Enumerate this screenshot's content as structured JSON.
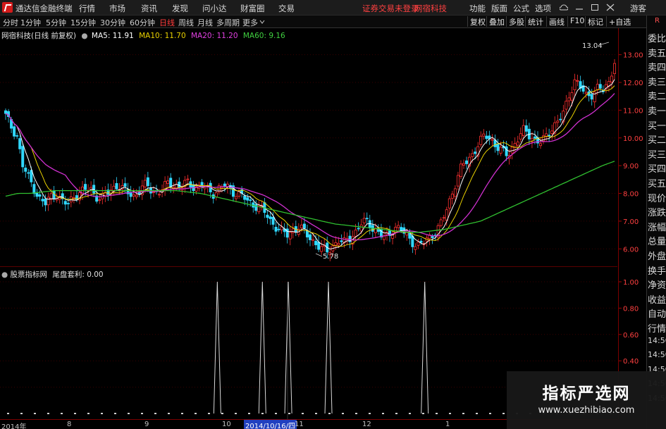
{
  "app": {
    "title": "通达信金融终端",
    "menu": [
      "行情",
      "市场",
      "资讯",
      "发现",
      "问小达",
      "财富圈",
      "交易"
    ],
    "notice_warn": "证券交易未登录",
    "notice_stock": "网宿科技",
    "right_menu": [
      "功能",
      "版面",
      "公式",
      "选项"
    ],
    "guest": "游客"
  },
  "toolbar": {
    "periods": [
      "分时",
      "1分钟",
      "5分钟",
      "15分钟",
      "30分钟",
      "60分钟",
      "日线",
      "周线",
      "月线",
      "多周期",
      "更多"
    ],
    "active_period": "日线",
    "right_buttons": [
      "复权",
      "叠加",
      "多股",
      "统计",
      "画线",
      "F10",
      "标记",
      "+自选"
    ]
  },
  "main_chart": {
    "header": "网宿科技(日线 前复权)",
    "ma": [
      {
        "label": "MA5: 11.91",
        "color": "#ffffff"
      },
      {
        "label": "MA10: 11.70",
        "color": "#e8d000"
      },
      {
        "label": "MA20: 11.20",
        "color": "#e040e0"
      },
      {
        "label": "MA60: 9.16",
        "color": "#40d040"
      }
    ],
    "high_label": "13.04",
    "low_label": "5.78"
  },
  "sub_chart": {
    "header": "股票指标网",
    "indicator": "尾盘套利: 0.00"
  },
  "axis": {
    "price_ticks": [
      "13.00",
      "12.00",
      "11.00",
      "10.00",
      "9.00",
      "8.00",
      "7.00",
      "6.00"
    ],
    "sub_ticks": [
      "1.00",
      "0.80",
      "0.60",
      "0.40"
    ],
    "date_labels": [
      "2014年",
      "8",
      "9",
      "10",
      "11",
      "12",
      "1"
    ],
    "highlight_date": "2014/10/16/四"
  },
  "sidebar": {
    "top_label": "R",
    "items": [
      "委比",
      "卖五",
      "卖四",
      "卖三",
      "卖二",
      "卖一",
      "买一",
      "买二",
      "买三",
      "买四",
      "买五",
      "现价",
      "涨跌",
      "涨幅",
      "总量",
      "外盘",
      "换手",
      "净资",
      "收益",
      "自动",
      "行情",
      "14:50",
      "14:50",
      "14:50",
      "14:50",
      "14:50"
    ]
  },
  "watermark": {
    "title": "指标严选网",
    "url": "www.xuezhibiao.com"
  },
  "chart_data": {
    "type": "candlestick",
    "price_range": [
      5.5,
      13.6
    ],
    "close_series_approx": [
      10.8,
      10.4,
      10.1,
      9.0,
      8.6,
      8.2,
      7.8,
      7.6,
      7.9,
      8.0,
      7.7,
      7.6,
      7.9,
      8.0,
      8.1,
      8.2,
      7.9,
      7.8,
      8.0,
      8.2,
      8.3,
      8.1,
      8.0,
      7.9,
      8.2,
      8.3,
      8.1,
      8.0,
      8.2,
      8.4,
      8.3,
      8.2,
      8.4,
      8.3,
      8.2,
      8.3,
      8.1,
      8.0,
      8.2,
      8.3,
      8.1,
      8.0,
      7.9,
      7.7,
      7.6,
      7.5,
      7.3,
      7.0,
      6.8,
      6.6,
      6.5,
      6.7,
      6.8,
      6.6,
      6.4,
      6.2,
      6.0,
      5.9,
      6.1,
      6.3,
      6.2,
      6.4,
      6.6,
      6.9,
      7.0,
      6.8,
      6.6,
      6.4,
      6.5,
      6.8,
      6.7,
      6.5,
      6.3,
      6.1,
      6.2,
      6.4,
      6.6,
      6.8,
      7.3,
      7.9,
      8.5,
      9.0,
      9.2,
      9.5,
      9.8,
      10.1,
      10.0,
      9.7,
      9.5,
      9.4,
      9.7,
      10.0,
      10.3,
      10.1,
      9.9,
      9.8,
      10.1,
      10.4,
      10.6,
      10.9,
      11.6,
      12.1,
      11.8,
      11.5,
      11.6,
      11.8,
      11.7,
      12.0,
      12.8
    ],
    "ma60_series_approx": [
      7.9,
      8.0,
      8.0,
      8.05,
      8.1,
      8.1,
      8.1,
      8.1,
      8.1,
      8.1,
      8.1,
      8.1,
      8.1,
      8.1,
      8.1,
      8.05,
      8.0,
      7.9,
      7.8,
      7.7,
      7.6,
      7.5,
      7.4,
      7.3,
      7.2,
      7.1,
      7.0,
      6.9,
      6.85,
      6.8,
      6.75,
      6.7,
      6.65,
      6.6,
      6.6,
      6.65,
      6.7,
      6.8,
      6.9,
      7.0,
      7.2,
      7.4,
      7.6,
      7.8,
      8.0,
      8.2,
      8.4,
      8.6,
      8.8,
      9.0,
      9.16
    ],
    "indicator": {
      "name": "尾盘套利",
      "range": [
        0,
        1.0
      ],
      "spike_dates_index": [
        0.352,
        0.425,
        0.467,
        0.532,
        0.688
      ],
      "spike_value": 1.0
    }
  }
}
